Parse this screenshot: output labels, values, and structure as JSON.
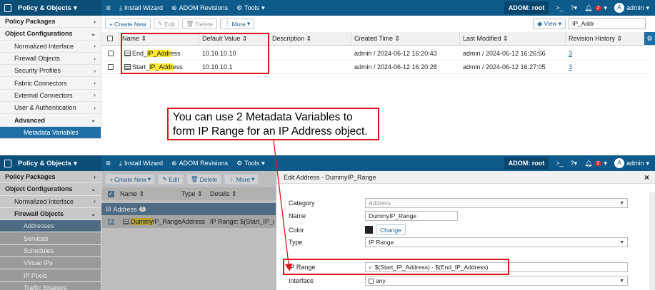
{
  "top": {
    "header": {
      "module": "Policy & Objects",
      "install_wizard": "Install Wizard",
      "adom_revisions": "ADOM Revisions",
      "tools": "Tools",
      "adom": "ADOM: root",
      "notif_count": "2",
      "avatar_letter": "A",
      "user": "admin"
    },
    "sidebar": [
      {
        "label": "Policy Packages",
        "chev": "›"
      },
      {
        "label": "Object Configurations",
        "chev": "⌄"
      },
      {
        "label": "Normalized Interface",
        "chev": "›"
      },
      {
        "label": "Firewall Objects",
        "chev": "›"
      },
      {
        "label": "Security Profiles",
        "chev": "›"
      },
      {
        "label": "Fabric Connectors",
        "chev": "›"
      },
      {
        "label": "External Connectors",
        "chev": "›"
      },
      {
        "label": "User & Authentication",
        "chev": "›"
      },
      {
        "label": "Advanced",
        "chev": "⌄"
      },
      {
        "label": "Metadata Variables",
        "chev": ""
      }
    ],
    "toolbar": {
      "create_new": "Create New",
      "edit": "Edit",
      "delete": "Delete",
      "more": "More",
      "view": "View",
      "search_value": "IP_Addr"
    },
    "columns": [
      "Name",
      "Default Value",
      "Description",
      "Created Time",
      "Last Modified",
      "Revision History"
    ],
    "rows": [
      {
        "name_pre": "End_",
        "name_hl": "IP_Addr",
        "name_post": "ess",
        "default_value": "10.10.10.10",
        "description": "",
        "created": "admin / 2024-06-12 16:20:43",
        "modified": "admin / 2024-06-12 16:26:56",
        "revision": "3"
      },
      {
        "name_pre": "Start_",
        "name_hl": "IP_Addr",
        "name_post": "ess",
        "default_value": "10.10.10.1",
        "description": "",
        "created": "admin / 2024-06-12 16:20:28",
        "modified": "admin / 2024-06-12 16:27:05",
        "revision": "3"
      }
    ]
  },
  "callout": {
    "line1": "You can use 2 Metadata Variables to",
    "line2": "form IP Range for an IP Address object."
  },
  "bottom": {
    "header": {
      "module": "Policy & Objects",
      "install_wizard": "Install Wizard",
      "adom_revisions": "ADOM Revisions",
      "tools": "Tools",
      "adom": "ADOM: root",
      "notif_count": "2",
      "avatar_letter": "A",
      "user": "admin"
    },
    "sidebar": [
      {
        "label": "Policy Packages",
        "chev": "›"
      },
      {
        "label": "Object Configurations",
        "chev": "⌄"
      },
      {
        "label": "Normalized Interface",
        "chev": "›"
      },
      {
        "label": "Firewall Objects",
        "chev": "⌄"
      },
      {
        "label": "Addresses",
        "chev": ""
      },
      {
        "label": "Services",
        "chev": ""
      },
      {
        "label": "Schedules",
        "chev": ""
      },
      {
        "label": "Virtual IPs",
        "chev": ""
      },
      {
        "label": "IP Pools",
        "chev": ""
      },
      {
        "label": "Traffic Shapers",
        "chev": ""
      }
    ],
    "toolbar": {
      "create_new": "Create New",
      "edit": "Edit",
      "delete": "Delete",
      "more": "More"
    },
    "columns": [
      "Name",
      "Type",
      "Details"
    ],
    "group": {
      "label": "Address",
      "count": "1"
    },
    "row": {
      "name_hl": "Dummy",
      "name_post": "IP_Range",
      "type": "Address",
      "details": "IP Range: $(Start_IP_A"
    },
    "panel": {
      "title": "Edit Address - DummyIP_Range",
      "close": "×",
      "category_label": "Category",
      "category_value": "Address",
      "name_label": "Name",
      "name_value": "DummyIP_Range",
      "color_label": "Color",
      "color_change": "Change",
      "type_label": "Type",
      "type_value": "IP Range",
      "iprange_label": "IP Range",
      "iprange_value": "$(Start_IP_Address) - $(End_IP_Address)",
      "interface_label": "Interface",
      "interface_value": "any"
    }
  },
  "colors": {
    "header": "#0e5a8a",
    "selected": "#1d6fa5",
    "highlight": "#ffe633",
    "annotation": "#e0161c"
  }
}
